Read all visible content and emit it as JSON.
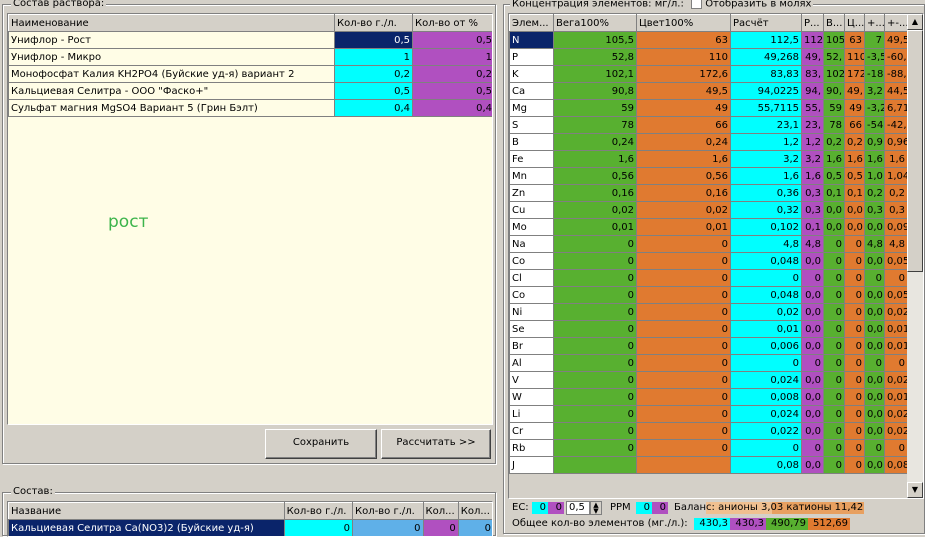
{
  "colors": {
    "green": "#58b030",
    "orange": "#e07a30",
    "cyan": "#00ffff",
    "purple": "#b050c0",
    "navy": "#0a246a",
    "label_green": "#3cb44b",
    "status_anion": "#f0c090",
    "status_cation": "#e07a30"
  },
  "solution": {
    "caption": "Состав раствора:",
    "headers": [
      "Наименование",
      "Кол-во г./л.",
      "Кол-во от %"
    ],
    "rows": [
      {
        "name": "Унифлор - Рост",
        "g": "0,5",
        "pct": "0,5"
      },
      {
        "name": "Унифлор - Микро",
        "g": "1",
        "pct": "1"
      },
      {
        "name": "Монофосфат Калия KH2PO4 (Буйские уд-я) вариант 2",
        "g": "0,2",
        "pct": "0,2"
      },
      {
        "name": "Кальциевая Селитра - ООО \"Фаско+\"",
        "g": "0,5",
        "pct": "0,5"
      },
      {
        "name": "Сульфат магния MgSO4 Вариант 5 (Грин Бэлт)",
        "g": "0,4",
        "pct": "0,4"
      }
    ],
    "label": "рост",
    "save_button": "Сохранить",
    "calc_button": "Рассчитать >>"
  },
  "composition": {
    "caption": "Состав:",
    "headers": [
      "Название",
      "Кол-во г./л.",
      "Кол-во г./л.",
      "Кол...",
      "Кол..."
    ],
    "rows": [
      {
        "name": "Кальциевая Селитра Ca(NO3)2 (Буйские уд-я)",
        "a": "0",
        "b": "0",
        "c": "0",
        "d": "0"
      }
    ]
  },
  "concentration": {
    "caption": "Концентрация элементов: мг/л.:",
    "show_moles_label": "Отобразить в молях",
    "headers": [
      "Элем...",
      "Вега100%",
      "Цвет100%",
      "Расчёт",
      "Р...",
      "В...",
      "Ц...",
      "+...",
      "+-..."
    ],
    "rows": [
      [
        "N",
        "105,5",
        "63",
        "112,5",
        "112",
        "105",
        "63",
        "7",
        "49,5"
      ],
      [
        "P",
        "52,8",
        "110",
        "49,268",
        "49,",
        "52,",
        "110",
        "-3,5",
        "-60,"
      ],
      [
        "K",
        "102,1",
        "172,6",
        "83,83",
        "83,",
        "102",
        "172",
        "-18",
        "-88,"
      ],
      [
        "Ca",
        "90,8",
        "49,5",
        "94,0225",
        "94,",
        "90,",
        "49,",
        "3,2",
        "44,5"
      ],
      [
        "Mg",
        "59",
        "49",
        "55,7115",
        "55,",
        "59",
        "49",
        "-3,2",
        "6,71"
      ],
      [
        "S",
        "78",
        "66",
        "23,1",
        "23,",
        "78",
        "66",
        "-54",
        "-42,"
      ],
      [
        "B",
        "0,24",
        "0,24",
        "1,2",
        "1,2",
        "0,2",
        "0,2",
        "0,9",
        "0,96"
      ],
      [
        "Fe",
        "1,6",
        "1,6",
        "3,2",
        "3,2",
        "1,6",
        "1,6",
        "1,6",
        "1,6"
      ],
      [
        "Mn",
        "0,56",
        "0,56",
        "1,6",
        "1,6",
        "0,5",
        "0,5",
        "1,0",
        "1,04"
      ],
      [
        "Zn",
        "0,16",
        "0,16",
        "0,36",
        "0,3",
        "0,1",
        "0,1",
        "0,2",
        "0,2"
      ],
      [
        "Cu",
        "0,02",
        "0,02",
        "0,32",
        "0,3",
        "0,0",
        "0,0",
        "0,3",
        "0,3"
      ],
      [
        "Mo",
        "0,01",
        "0,01",
        "0,102",
        "0,1",
        "0,0",
        "0,0",
        "0,0",
        "0,09"
      ],
      [
        "Na",
        "0",
        "0",
        "4,8",
        "4,8",
        "0",
        "0",
        "4,8",
        "4,8"
      ],
      [
        "Co",
        "0",
        "0",
        "0,048",
        "0,0",
        "0",
        "0",
        "0,0",
        "0,05"
      ],
      [
        "Cl",
        "0",
        "0",
        "0",
        "0",
        "0",
        "0",
        "0",
        "0"
      ],
      [
        "Co",
        "0",
        "0",
        "0,048",
        "0,0",
        "0",
        "0",
        "0,0",
        "0,05"
      ],
      [
        "Ni",
        "0",
        "0",
        "0,02",
        "0,0",
        "0",
        "0",
        "0,0",
        "0,02"
      ],
      [
        "Se",
        "0",
        "0",
        "0,01",
        "0,0",
        "0",
        "0",
        "0,0",
        "0,01"
      ],
      [
        "Br",
        "0",
        "0",
        "0,006",
        "0,0",
        "0",
        "0",
        "0,0",
        "0,01"
      ],
      [
        "Al",
        "0",
        "0",
        "0",
        "0",
        "0",
        "0",
        "0",
        "0"
      ],
      [
        "V",
        "0",
        "0",
        "0,024",
        "0,0",
        "0",
        "0",
        "0,0",
        "0,02"
      ],
      [
        "W",
        "0",
        "0",
        "0,008",
        "0,0",
        "0",
        "0",
        "0,0",
        "0,01"
      ],
      [
        "Li",
        "0",
        "0",
        "0,024",
        "0,0",
        "0",
        "0",
        "0,0",
        "0,02"
      ],
      [
        "Cr",
        "0",
        "0",
        "0,022",
        "0,0",
        "0",
        "0",
        "0,0",
        "0,02"
      ],
      [
        "Rb",
        "0",
        "0",
        "0",
        "0",
        "0",
        "0",
        "0",
        "0"
      ],
      [
        "J",
        "",
        "",
        "0,08",
        "0,0",
        "0",
        "0",
        "0,0",
        "0,08"
      ]
    ],
    "status": {
      "ec_label": "EC:",
      "ec_a": "0",
      "ec_b": "0",
      "ec_input": "0,5",
      "ppm_label": "PPM",
      "ppm_a": "0",
      "ppm_b": "0",
      "balance": "Баланс:  анионы 3,03  катионы 11,42",
      "total_label": "Общее кол-во элементов (мг./л.):",
      "totals": [
        "430,3",
        "430,3",
        "490,79",
        "512,69"
      ]
    }
  }
}
